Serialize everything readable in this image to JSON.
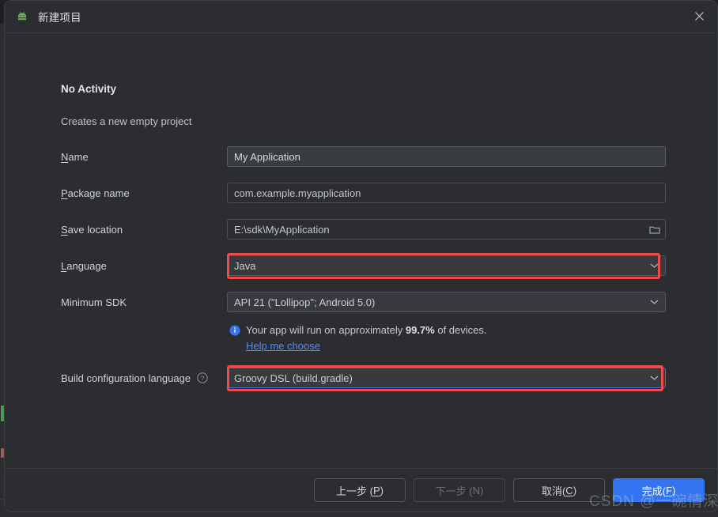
{
  "window": {
    "title": "新建项目",
    "app_icon": "android-icon",
    "close_icon": "close-icon"
  },
  "step": {
    "title": "No Activity",
    "subtitle": "Creates a new empty project"
  },
  "form": {
    "name": {
      "label_mnemonic": "N",
      "label_rest": "ame",
      "value": "My Application"
    },
    "package_name": {
      "label_mnemonic": "P",
      "label_rest": "ackage name",
      "value": "com.example.myapplication"
    },
    "save_location": {
      "label_mnemonic": "S",
      "label_rest": "ave location",
      "value": "E:\\sdk\\MyApplication",
      "browse_icon": "folder-icon"
    },
    "language": {
      "label_mnemonic": "L",
      "label_rest": "anguage",
      "value": "Java",
      "chevron_icon": "chevron-down-icon",
      "highlighted": true
    },
    "minimum_sdk": {
      "label_mnemonic": "M",
      "label_rest": "inimum SDK",
      "value": "API 21 (\"Lollipop\"; Android 5.0)",
      "chevron_icon": "chevron-down-icon"
    },
    "build_config": {
      "label_mnemonic": "B",
      "label_rest": "uild configuration language",
      "help_icon": "help-circle-icon",
      "value": "Groovy DSL (build.gradle)",
      "chevron_icon": "chevron-down-icon",
      "highlighted": true
    }
  },
  "info": {
    "icon": "info-icon",
    "text_before": "Your app will run on approximately ",
    "percent": "99.7%",
    "text_after": " of devices.",
    "link": "Help me choose"
  },
  "footer": {
    "previous": "上一步 (P)",
    "previous_plain": "上一步 (",
    "previous_mn": "P",
    "previous_tail": ")",
    "next_plain": "下一步 (",
    "next_mn": "N",
    "next_tail": ")",
    "cancel_plain": "取消(",
    "cancel_mn": "C",
    "cancel_tail": ")",
    "finish_plain": "完成(",
    "finish_mn": "F",
    "finish_tail": ")"
  },
  "watermark": "CSDN @一碗情深",
  "colors": {
    "annotation_red": "#f04b4b",
    "primary_blue": "#3574f0",
    "link_blue": "#548af7",
    "dialog_bg": "#2b2d30"
  }
}
